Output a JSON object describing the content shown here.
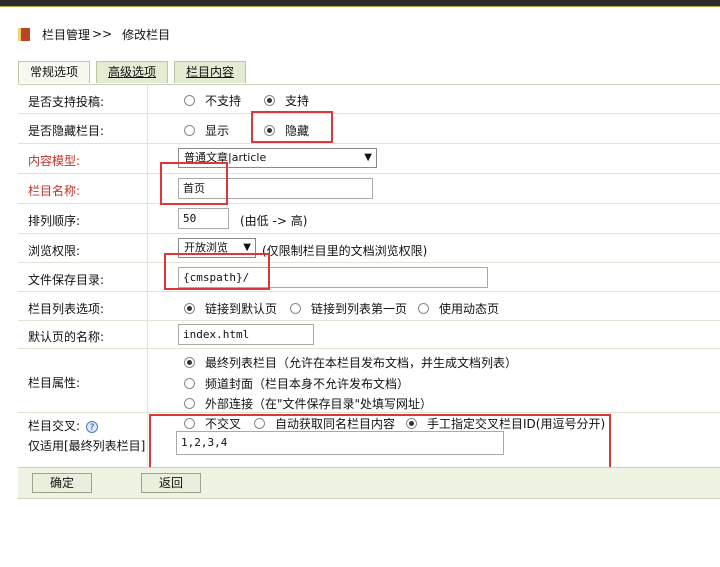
{
  "breadcrumb": {
    "section": "栏目管理",
    "separator": ">>",
    "page": "修改栏目"
  },
  "tabs": [
    {
      "label": "常规选项"
    },
    {
      "label": "高级选项"
    },
    {
      "label": "栏目内容"
    }
  ],
  "fields": {
    "submission": {
      "label": "是否支持投稿:",
      "options": [
        "不支持",
        "支持"
      ],
      "selected": "支持"
    },
    "hidden": {
      "label": "是否隐藏栏目:",
      "options": [
        "显示",
        "隐藏"
      ],
      "selected": "隐藏"
    },
    "content_model": {
      "label": "内容模型:",
      "value": "普通文章|article",
      "arrow": "▼"
    },
    "name": {
      "label": "栏目名称:",
      "value": "首页"
    },
    "sort": {
      "label": "排列顺序:",
      "value": "50",
      "hint": "(由低 -> 高)"
    },
    "access": {
      "label": "浏览权限:",
      "value": "开放浏览",
      "arrow": "▼",
      "hint": "(仅限制栏目里的文档浏览权限)"
    },
    "save_dir": {
      "label": "文件保存目录:",
      "value": "{cmspath}/"
    },
    "list_option": {
      "label": "栏目列表选项:",
      "options": [
        "链接到默认页",
        "链接到列表第一页",
        "使用动态页"
      ],
      "selected": "链接到默认页"
    },
    "default_page": {
      "label": "默认页的名称:",
      "value": "index.html"
    },
    "attribute": {
      "label": "栏目属性:",
      "options": [
        "最终列表栏目（允许在本栏目发布文档，并生成文档列表）",
        "频道封面（栏目本身不允许发布文档）",
        "外部连接（在\"文件保存目录\"处填写网址）"
      ],
      "selected": "最终列表栏目（允许在本栏目发布文档，并生成文档列表）"
    },
    "cross": {
      "label": "栏目交叉:",
      "help_icon": "?",
      "sublabel": "仅适用[最终列表栏目]",
      "options": [
        "不交叉",
        "自动获取同名栏目内容",
        "手工指定交叉栏目ID(用逗号分开)"
      ],
      "selected": "手工指定交叉栏目ID(用逗号分开)",
      "value": "1,2,3,4"
    }
  },
  "buttons": {
    "confirm": "确定",
    "back": "返回"
  },
  "colors": {
    "required_label": "#c0322b",
    "highlight": "#e2353a",
    "tab_bg": "#e3ecd2"
  }
}
